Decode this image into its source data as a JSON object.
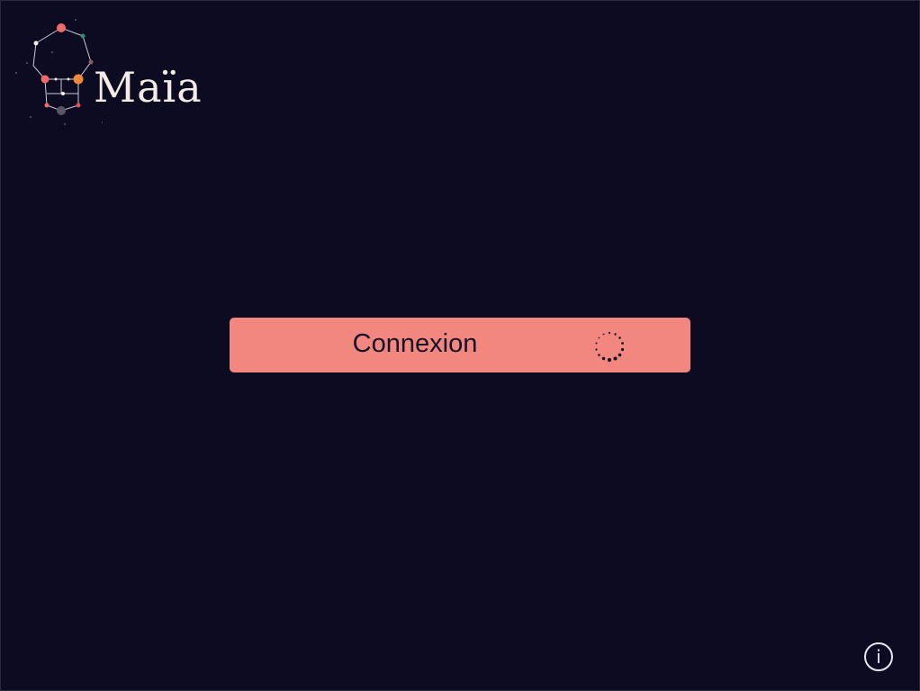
{
  "app": {
    "name": "Maïa"
  },
  "login": {
    "button_label": "Connexion",
    "state": "loading"
  },
  "info_button": {
    "glyph": "i"
  },
  "colors": {
    "background": "#0d0b21",
    "accent": "#f2877f",
    "wordmark": "#f3ece6"
  },
  "icons": {
    "logo": "constellation-logo-icon",
    "spinner": "loading-spinner-icon",
    "info": "info-icon"
  }
}
